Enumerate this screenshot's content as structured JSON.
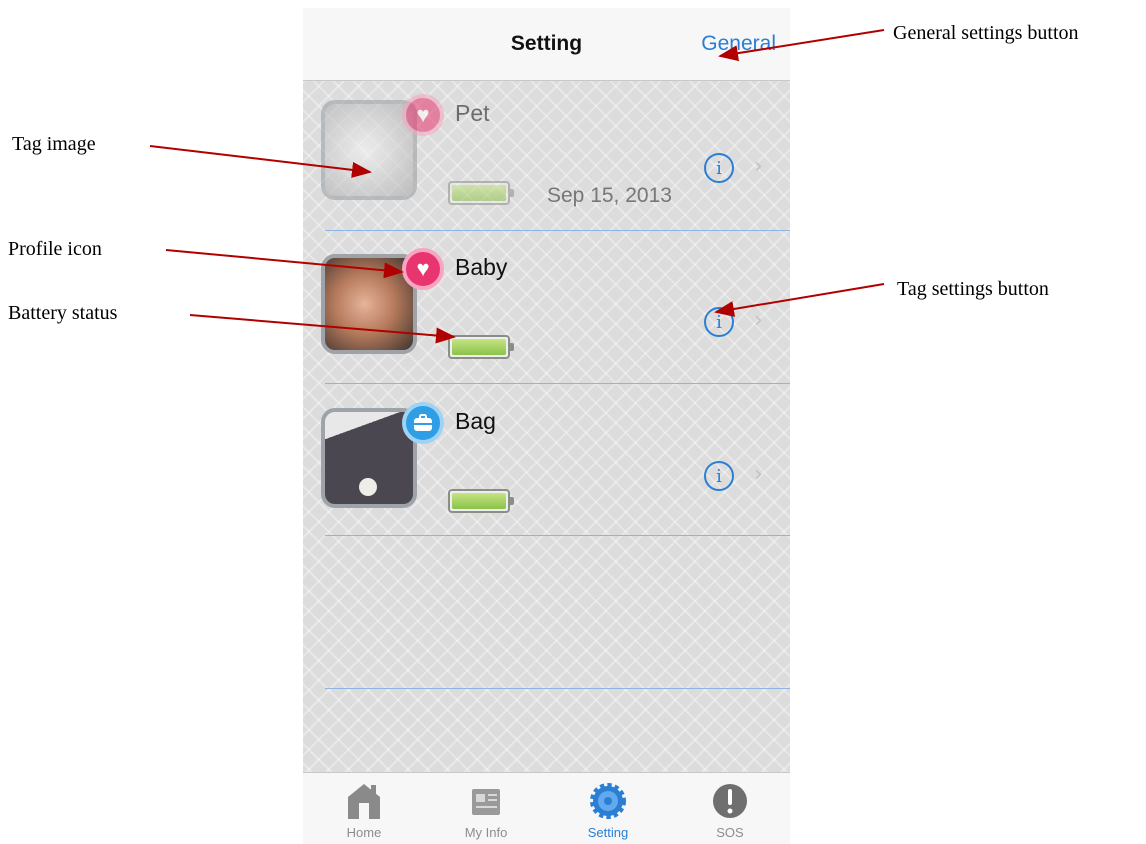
{
  "navbar": {
    "title": "Setting",
    "general_label": "General"
  },
  "tags": [
    {
      "name": "Pet",
      "profile_icon": "heart-icon",
      "battery_level": 1.0,
      "date": "Sep 15, 2013",
      "dimmed": true
    },
    {
      "name": "Baby",
      "profile_icon": "heart-icon",
      "battery_level": 1.0,
      "date": ""
    },
    {
      "name": "Bag",
      "profile_icon": "briefcase-icon",
      "battery_level": 1.0,
      "date": ""
    }
  ],
  "tabbar": {
    "items": [
      {
        "label": "Home",
        "icon": "home-icon"
      },
      {
        "label": "My Info",
        "icon": "newspaper-icon"
      },
      {
        "label": "Setting",
        "icon": "gear-icon",
        "active": true
      },
      {
        "label": "SOS",
        "icon": "alert-icon"
      }
    ]
  },
  "annotations": {
    "general_settings": "General settings button",
    "tag_image": "Tag image",
    "profile_icon": "Profile icon",
    "battery_status": "Battery status",
    "tag_settings": "Tag settings button"
  },
  "colors": {
    "accent": "#2a7fd4",
    "arrow": "#b00000",
    "heart": "#e8356f",
    "briefcase": "#2f9ee4",
    "battery": "#8bc24a"
  }
}
